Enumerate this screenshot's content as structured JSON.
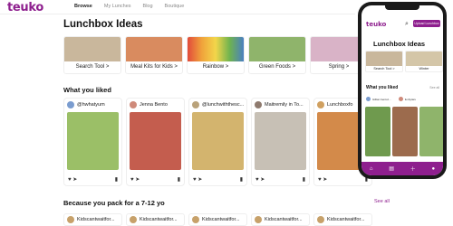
{
  "app": {
    "logo": "teuko"
  },
  "nav": {
    "items": [
      "Browse",
      "My Lunches",
      "Blog",
      "Boutique"
    ]
  },
  "page_title": "Lunchbox Ideas",
  "categories": [
    {
      "label": "Search Tool >",
      "color": "#c9b79c"
    },
    {
      "label": "Meal Kits for Kids >",
      "color": "#d98b5f"
    },
    {
      "label": "Rainbow >",
      "color": "#e3a14a"
    },
    {
      "label": "Green Foods >",
      "color": "#8fb46b"
    },
    {
      "label": "Spring >",
      "color": "#d9b3c7"
    }
  ],
  "liked": {
    "heading": "What you liked",
    "cards": [
      {
        "user": "@hwhatyum",
        "color": "#9bbf67"
      },
      {
        "user": "Jenna Bento",
        "color": "#c45d4e"
      },
      {
        "user": "@lunchwiththesc...",
        "color": "#d3b46e"
      },
      {
        "user": "Maitremily in To...",
        "color": "#c7c0b5"
      },
      {
        "user": "Lunchboxfo",
        "color": "#d38a4a"
      }
    ]
  },
  "age_section": {
    "heading": "Because you pack for a 7-12 yo",
    "see_all": "See all",
    "items": [
      "Kidscantwaitfor...",
      "Kidscantwaitfor...",
      "Kidscantwaitfor...",
      "Kidscantwaitfor...",
      "Kidscantwaitfor..."
    ]
  },
  "phone": {
    "logo": "teuko",
    "upload": "Upload Lunchbox",
    "title": "Lunchbox Ideas",
    "categories": [
      {
        "label": "Search Tool >",
        "color": "#c9b79c"
      },
      {
        "label": "Winter",
        "color": "#d4c6a8"
      }
    ],
    "liked_heading": "What you liked",
    "see_all": "See all",
    "users": [
      "Gillian bentoz...",
      "funbylaru"
    ],
    "photos": [
      "#6f9a4e",
      "#9c6b4d",
      "#8fb46b"
    ]
  },
  "brand_color": "#8e1f8e"
}
